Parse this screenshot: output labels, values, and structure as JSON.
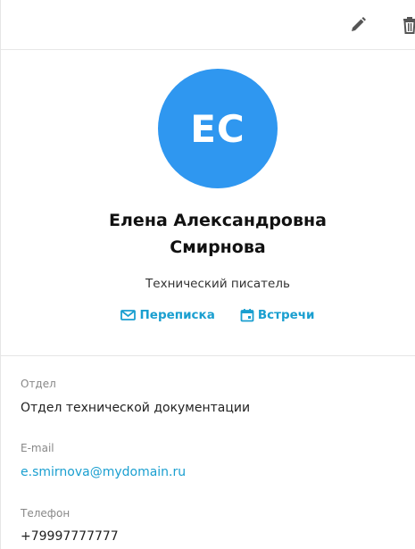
{
  "toolbar": {
    "edit_icon": "pencil-icon",
    "delete_icon": "trash-icon"
  },
  "profile": {
    "initials": "ЕС",
    "avatar_color": "#2f97f0",
    "name_line1": "Елена Александровна",
    "name_line2": "Смирнова",
    "position": "Технический писатель"
  },
  "actions": {
    "accent_color": "#1a9fd0",
    "correspondence_label": "Переписка",
    "meetings_label": "Встречи"
  },
  "details": {
    "department_label": "Отдел",
    "department_value": "Отдел технической документации",
    "email_label": "E-mail",
    "email_value": "e.smirnova@mydomain.ru",
    "phone_label": "Телефон",
    "phone_value": "+79997777777"
  }
}
